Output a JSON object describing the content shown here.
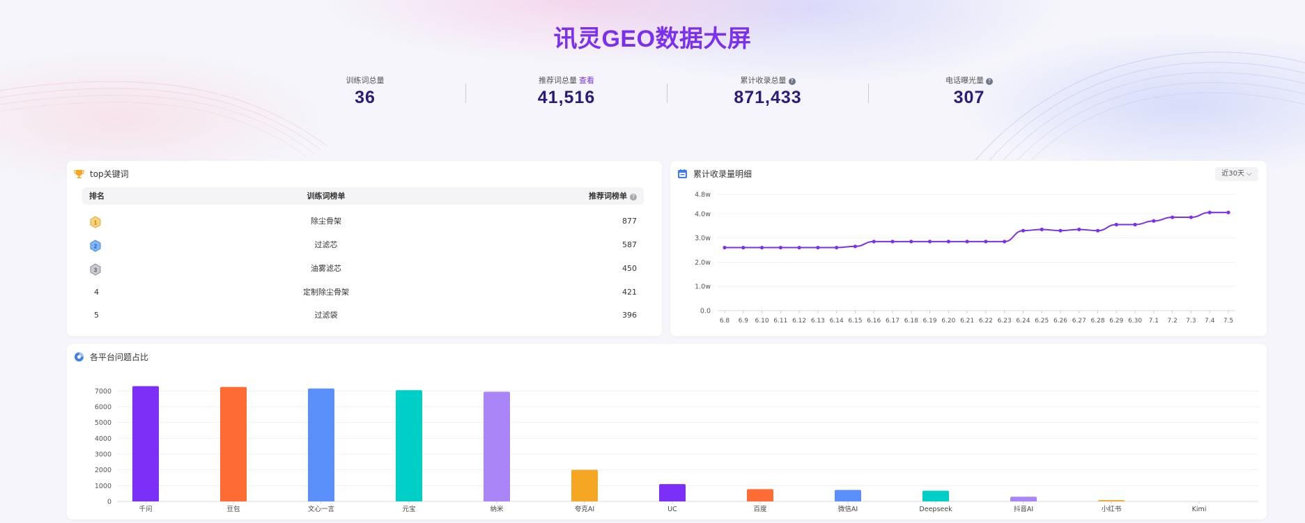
{
  "header": {
    "title": "讯灵GEO数据大屏"
  },
  "stats": [
    {
      "label": "训练词总量",
      "value": "36"
    },
    {
      "label": "推荐词总量",
      "link": "查看",
      "value": "41,516"
    },
    {
      "label": "累计收录总量",
      "help": "?",
      "value": "871,433"
    },
    {
      "label": "电话曝光量",
      "help": "?",
      "value": "307"
    }
  ],
  "top_keywords": {
    "title": "top关键词",
    "columns": {
      "rank": "排名",
      "keyword": "训练词榜单",
      "count": "推荐词榜单",
      "help": "?"
    },
    "rows": [
      {
        "rank": "1",
        "keyword": "除尘骨架",
        "count": "877"
      },
      {
        "rank": "2",
        "keyword": "过滤芯",
        "count": "587"
      },
      {
        "rank": "3",
        "keyword": "油雾滤芯",
        "count": "450"
      },
      {
        "rank": "4",
        "keyword": "定制除尘骨架",
        "count": "421"
      },
      {
        "rank": "5",
        "keyword": "过滤袋",
        "count": "396"
      }
    ]
  },
  "accum": {
    "title": "累计收录量明细",
    "range": "近30天"
  },
  "platform": {
    "title": "各平台问题占比"
  },
  "colors": {
    "accent": "#7b2ff0",
    "stat_value": "#2b1a7a",
    "bar_palette": [
      "#7b2ff7",
      "#ff6b35",
      "#5b8ff9",
      "#00cfc8",
      "#a985f7",
      "#f5a623"
    ]
  },
  "chart_data": [
    {
      "type": "line",
      "title": "累计收录量明细",
      "x": [
        "6.8",
        "6.9",
        "6.10",
        "6.11",
        "6.12",
        "6.13",
        "6.14",
        "6.15",
        "6.16",
        "6.17",
        "6.18",
        "6.19",
        "6.20",
        "6.21",
        "6.22",
        "6.23",
        "6.24",
        "6.25",
        "6.26",
        "6.27",
        "6.28",
        "6.29",
        "6.30",
        "7.1",
        "7.2",
        "7.3",
        "7.4",
        "7.5"
      ],
      "y_tick_labels": [
        "0.0",
        "1.0w",
        "2.0w",
        "3.0w",
        "4.0w",
        "4.8w"
      ],
      "ylim": [
        0,
        48000
      ],
      "series": [
        {
          "values": [
            26000,
            26000,
            26000,
            26000,
            26000,
            26000,
            26000,
            26500,
            28500,
            28500,
            28500,
            28500,
            28500,
            28500,
            28500,
            28500,
            33000,
            33500,
            33000,
            33500,
            33000,
            35500,
            35500,
            37000,
            38500,
            38500,
            40500,
            40500
          ]
        }
      ],
      "grid": true
    },
    {
      "type": "bar",
      "title": "各平台问题占比",
      "categories": [
        "千问",
        "豆包",
        "文心一言",
        "元宝",
        "纳米",
        "夸克AI",
        "UC",
        "百度",
        "微信AI",
        "Deepseek",
        "抖音AI",
        "小红书",
        "Kimi"
      ],
      "values": [
        7300,
        7250,
        7150,
        7050,
        6950,
        2000,
        1100,
        780,
        730,
        680,
        300,
        80,
        0
      ],
      "y_tick_labels": [
        "0",
        "1000",
        "2000",
        "3000",
        "4000",
        "5000",
        "6000",
        "7000"
      ],
      "ylim": [
        0,
        7500
      ],
      "grid": true
    }
  ]
}
